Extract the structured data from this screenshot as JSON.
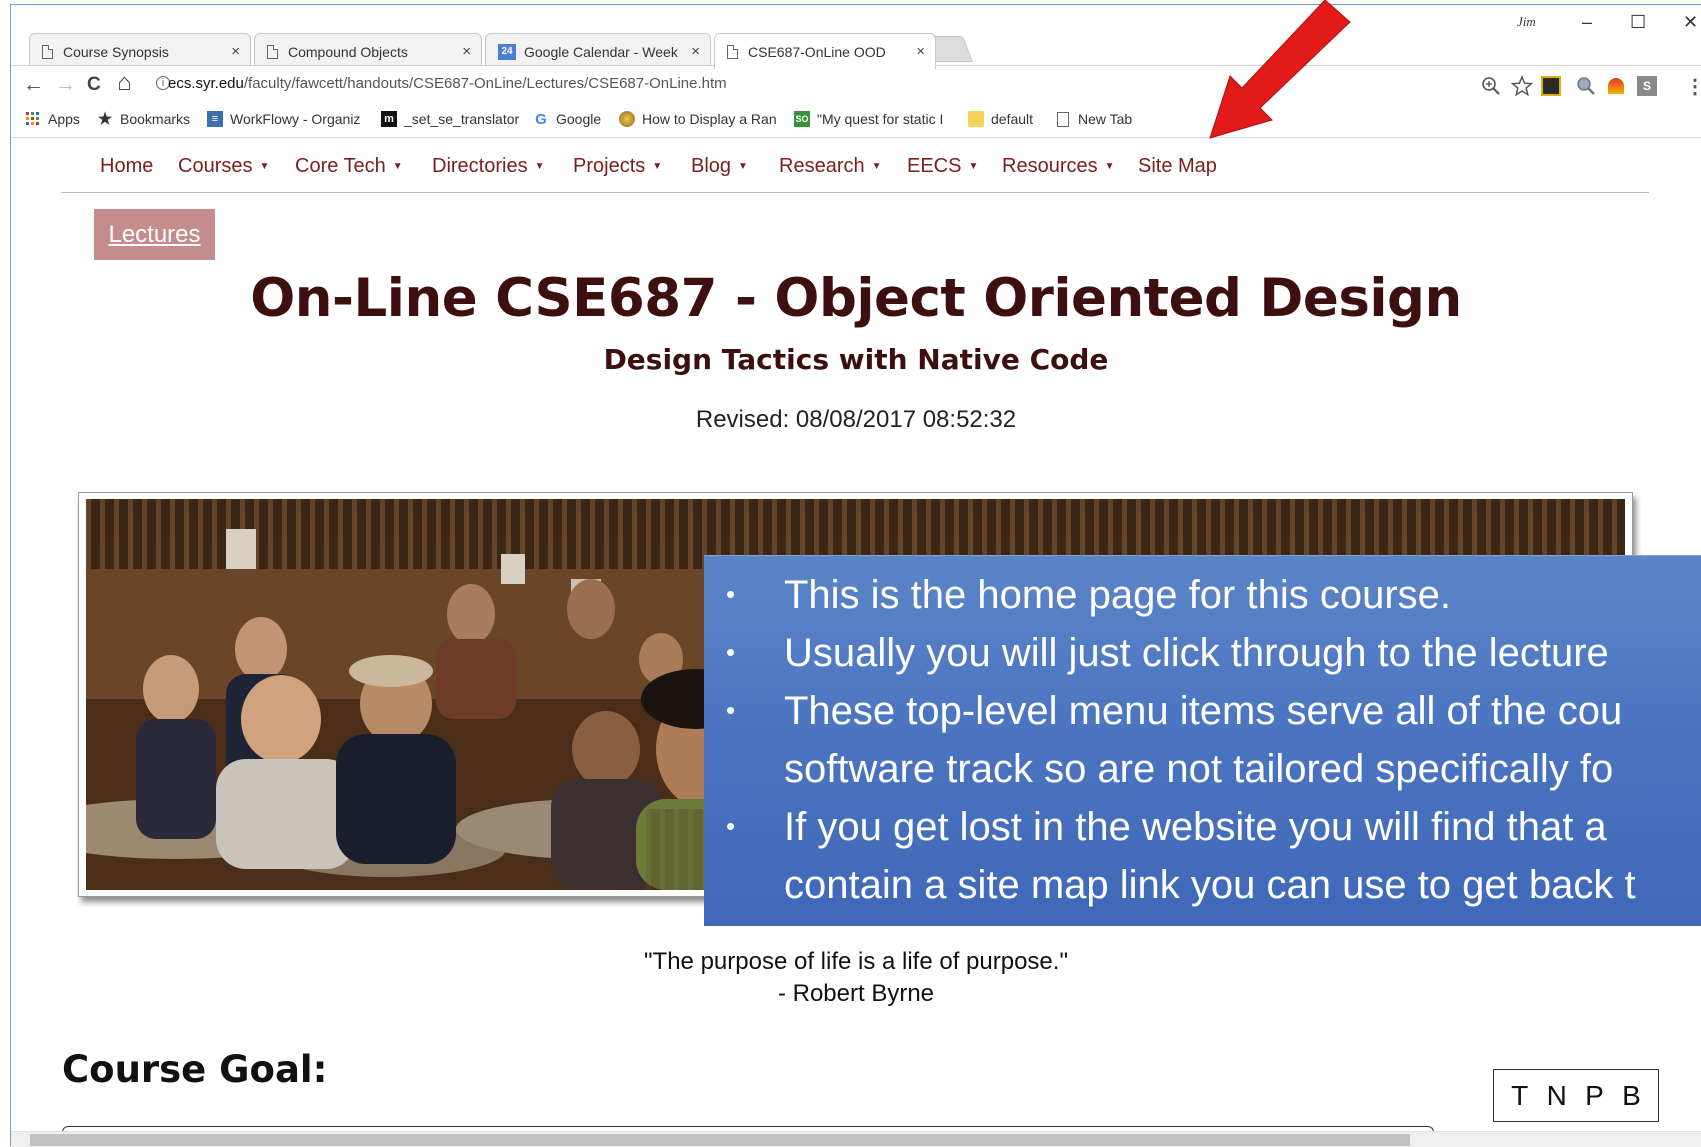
{
  "browser": {
    "user": "Jim",
    "tabs": [
      {
        "label": "Course Synopsis",
        "close": "×"
      },
      {
        "label": "Compound Objects",
        "close": "×"
      },
      {
        "label": "Google Calendar - Week",
        "badge": "24",
        "close": "×"
      },
      {
        "label": "CSE687-OnLine OOD",
        "close": "×"
      }
    ],
    "window_controls": {
      "minimize": "–",
      "maximize": "☐",
      "close": "✕"
    },
    "url_host": "ecs.syr.edu",
    "url_path": "/faculty/fawcett/handouts/CSE687-OnLine/Lectures/CSE687-OnLine.htm",
    "nav": {
      "back": "←",
      "forward": "→",
      "reload": "C",
      "home": "⌂"
    },
    "bookmarks": [
      {
        "label": "Apps",
        "icon": "apps-grid-icon"
      },
      {
        "label": "Bookmarks",
        "icon": "star-icon"
      },
      {
        "label": "WorkFlowy - Organiz",
        "icon": "workflowy-icon"
      },
      {
        "label": "_set_se_translator",
        "icon": "m-icon"
      },
      {
        "label": "Google",
        "icon": "google-g-icon"
      },
      {
        "label": "How to Display a Ran",
        "icon": "globe-icon"
      },
      {
        "label": "\"My quest for static I",
        "icon": "app-icon"
      },
      {
        "label": "default",
        "icon": "folder-icon"
      },
      {
        "label": "New Tab",
        "icon": "page-icon"
      }
    ]
  },
  "site_nav": [
    {
      "label": "Home",
      "dropdown": false
    },
    {
      "label": "Courses",
      "dropdown": true
    },
    {
      "label": "Core Tech",
      "dropdown": true
    },
    {
      "label": "Directories",
      "dropdown": true
    },
    {
      "label": "Projects",
      "dropdown": true
    },
    {
      "label": "Blog",
      "dropdown": true
    },
    {
      "label": "Research",
      "dropdown": true
    },
    {
      "label": "EECS",
      "dropdown": true
    },
    {
      "label": "Resources",
      "dropdown": true
    },
    {
      "label": "Site Map",
      "dropdown": false
    }
  ],
  "page": {
    "lectures_button": "Lectures",
    "title": "On-Line CSE687 - Object Oriented Design",
    "subtitle": "Design Tactics with Native Code",
    "revised": "Revised: 08/08/2017 08:52:32",
    "quote": "\"The purpose of life is a life of purpose.\"",
    "quote_author": "- Robert Byrne",
    "course_goal": "Course Goal:",
    "tnpb": [
      "T",
      "N",
      "P",
      "B"
    ]
  },
  "callout": {
    "bullets": [
      [
        "This is the home page for this course."
      ],
      [
        "Usually you will just click through to the lecture"
      ],
      [
        "These top-level menu items serve all of the cou",
        "software track so are not tailored specifically fo"
      ],
      [
        "If you get lost in the website you will find that a",
        "contain a site map link you can use to get back t"
      ]
    ],
    "bullet_char": "•"
  },
  "colors": {
    "accent": "#7a1f1f",
    "title": "#3d0f0f",
    "lectures_bg": "#c48c8c",
    "callout": "#4a74c0",
    "arrow": "#e31a1a"
  }
}
